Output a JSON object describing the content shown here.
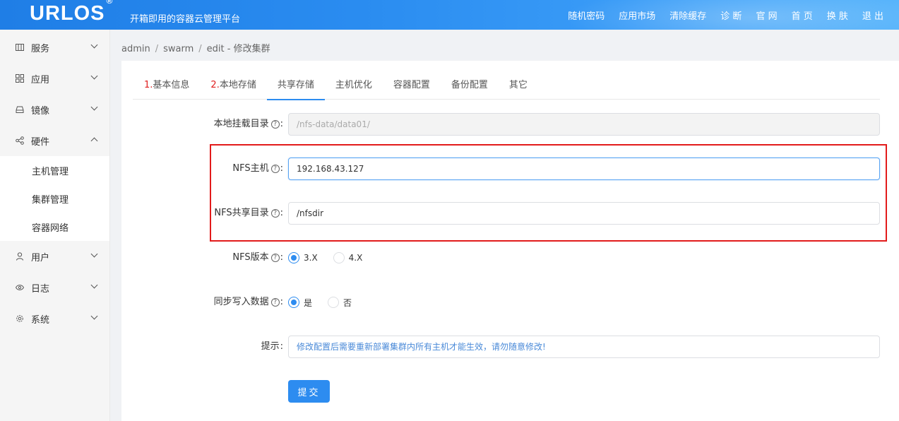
{
  "header": {
    "logo": "URLOS",
    "logo_mark": "®",
    "slogan": "开箱即用的容器云管理平台",
    "nav": [
      "随机密码",
      "应用市场",
      "清除缓存",
      "诊 断",
      "官 网",
      "首 页",
      "换 肤",
      "退 出"
    ]
  },
  "sidebar": {
    "items": [
      {
        "label": "服务",
        "icon": "grid-icon",
        "expanded": false
      },
      {
        "label": "应用",
        "icon": "apps-icon",
        "expanded": false
      },
      {
        "label": "镜像",
        "icon": "disk-icon",
        "expanded": false
      },
      {
        "label": "硬件",
        "icon": "share-icon",
        "expanded": true
      },
      {
        "label": "用户",
        "icon": "user-icon",
        "expanded": false
      },
      {
        "label": "日志",
        "icon": "eye-icon",
        "expanded": false
      },
      {
        "label": "系统",
        "icon": "gear-icon",
        "expanded": false
      }
    ],
    "hardware_sub": [
      "主机管理",
      "集群管理",
      "容器网络"
    ]
  },
  "breadcrumb": [
    "admin",
    "swarm",
    "edit - 修改集群"
  ],
  "tabs": [
    {
      "num": "1.",
      "label": "基本信息"
    },
    {
      "num": "2.",
      "label": "本地存储"
    },
    {
      "num": "",
      "label": "共享存储",
      "active": true
    },
    {
      "num": "",
      "label": "主机优化"
    },
    {
      "num": "",
      "label": "容器配置"
    },
    {
      "num": "",
      "label": "备份配置"
    },
    {
      "num": "",
      "label": "其它"
    }
  ],
  "form": {
    "mount_dir": {
      "label": "本地挂载目录",
      "value": "/nfs-data/data01/"
    },
    "nfs_host": {
      "label": "NFS主机",
      "value": "192.168.43.127"
    },
    "nfs_share_dir": {
      "label": "NFS共享目录",
      "value": "/nfsdir"
    },
    "nfs_version": {
      "label": "NFS版本",
      "options": [
        "3.X",
        "4.X"
      ],
      "selected": "3.X"
    },
    "sync_write": {
      "label": "同步写入数据",
      "options": [
        "是",
        "否"
      ],
      "selected": "是"
    },
    "tip": {
      "label": "提示",
      "value": "修改配置后需要重新部署集群内所有主机才能生效，请勿随意修改!"
    },
    "help_glyph": "?",
    "submit_label": "提交"
  },
  "colors": {
    "accent": "#2d8cf0",
    "highlight_box": "#e21b1b",
    "tab_number": "#e02020"
  }
}
